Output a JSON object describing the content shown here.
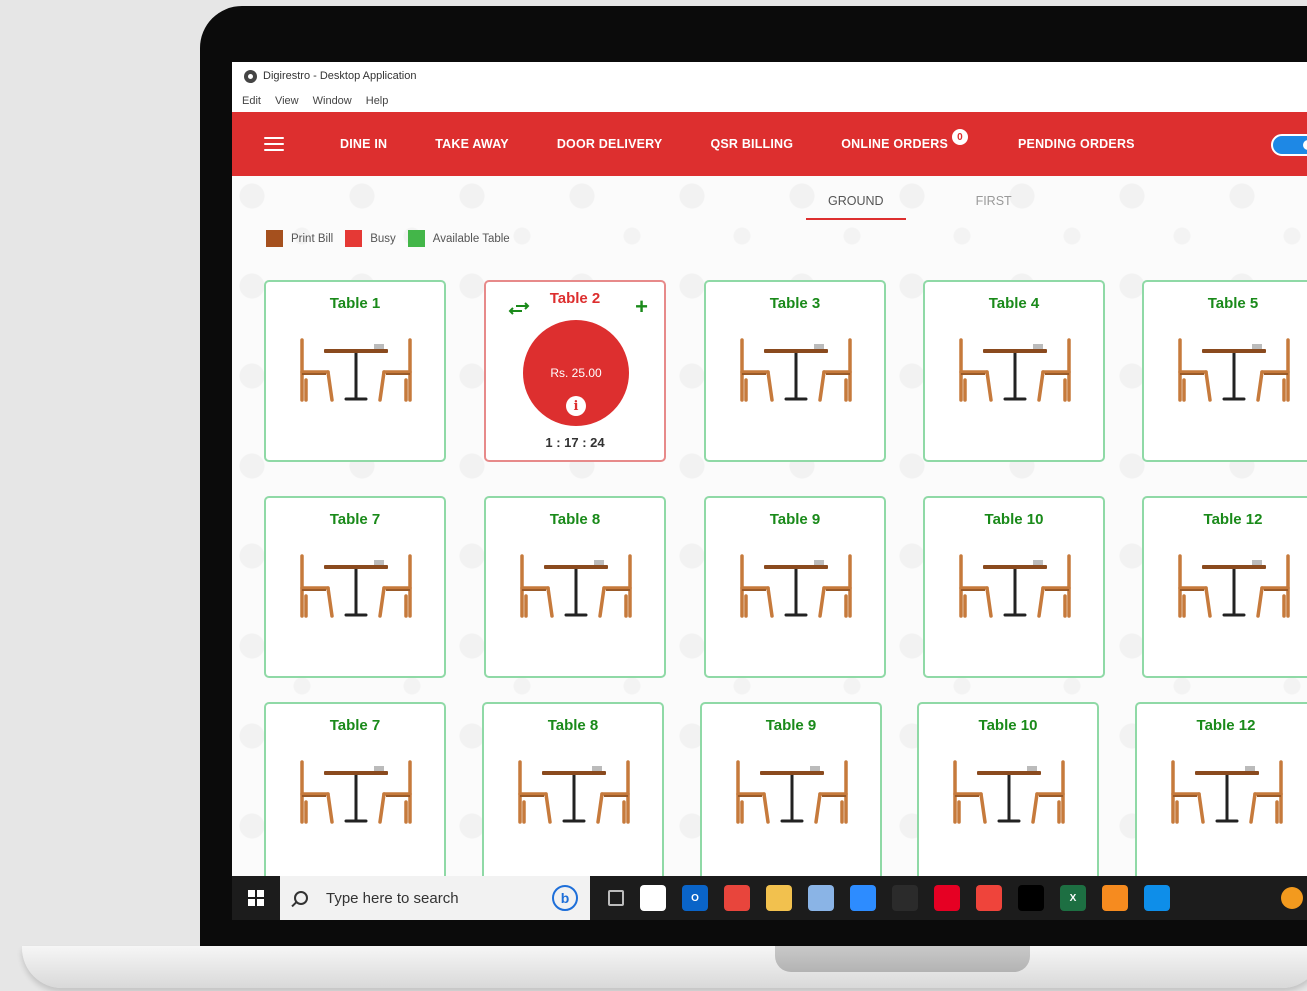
{
  "window": {
    "title": "Digirestro - Desktop Application"
  },
  "menubar": [
    "Edit",
    "View",
    "Window",
    "Help"
  ],
  "nav": {
    "items": [
      "DINE IN",
      "TAKE AWAY",
      "DOOR DELIVERY",
      "QSR BILLING",
      "ONLINE ORDERS",
      "PENDING ORDERS"
    ],
    "online_orders_badge": "0"
  },
  "floors": {
    "tabs": [
      "GROUND",
      "FIRST"
    ],
    "active": "GROUND"
  },
  "legend": [
    {
      "label": "Print Bill",
      "color": "#a5501e"
    },
    {
      "label": "Busy",
      "color": "#e53935"
    },
    {
      "label": "Available Table",
      "color": "#43b649"
    }
  ],
  "tables": [
    {
      "name": "Table 1",
      "status": "available"
    },
    {
      "name": "Table 2",
      "status": "busy",
      "amount": "Rs. 25.00",
      "timer": "1 : 17 : 24"
    },
    {
      "name": "Table 3",
      "status": "available"
    },
    {
      "name": "Table 4",
      "status": "available"
    },
    {
      "name": "Table 5",
      "status": "available"
    },
    {
      "name": "Table 7",
      "status": "available"
    },
    {
      "name": "Table 8",
      "status": "available"
    },
    {
      "name": "Table 9",
      "status": "available"
    },
    {
      "name": "Table 10",
      "status": "available"
    },
    {
      "name": "Table 12",
      "status": "available"
    },
    {
      "name": "Table 7",
      "status": "available"
    },
    {
      "name": "Table 8",
      "status": "available"
    },
    {
      "name": "Table 9",
      "status": "available"
    },
    {
      "name": "Table 10",
      "status": "available"
    },
    {
      "name": "Table 12",
      "status": "available"
    }
  ],
  "taskbar": {
    "search_placeholder": "Type here to search",
    "bing_label": "b",
    "apps": [
      {
        "name": "slack-icon",
        "color": "#ffffff"
      },
      {
        "name": "outlook-icon",
        "color": "#0a64c8",
        "text": "O"
      },
      {
        "name": "chrome-icon",
        "color": "#e8453c"
      },
      {
        "name": "file-explorer-icon",
        "color": "#f2c14e"
      },
      {
        "name": "notepad-icon",
        "color": "#8ab4e6"
      },
      {
        "name": "zoom-icon",
        "color": "#2d8cff"
      },
      {
        "name": "settings-icon",
        "color": "#2b2b2b"
      },
      {
        "name": "pinterest-icon",
        "color": "#e60023"
      },
      {
        "name": "anydesk-icon",
        "color": "#ef443b"
      },
      {
        "name": "terminal-icon",
        "color": "#000000"
      },
      {
        "name": "excel-icon",
        "color": "#1d6f42",
        "text": "X"
      },
      {
        "name": "vlc-icon",
        "color": "#f68b1f"
      },
      {
        "name": "teamviewer-icon",
        "color": "#0e8ee9"
      }
    ]
  }
}
